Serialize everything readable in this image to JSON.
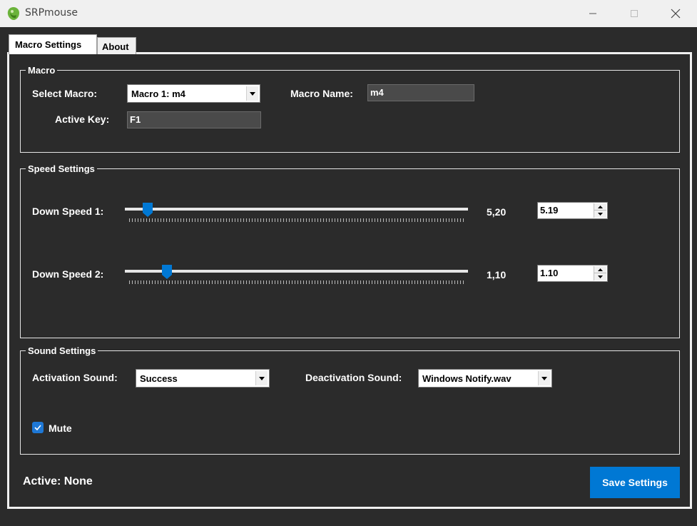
{
  "window": {
    "title": "SRPmouse"
  },
  "tabs": [
    {
      "label": "Macro Settings",
      "active": true
    },
    {
      "label": "About",
      "active": false
    }
  ],
  "macro_group": {
    "title": "Macro",
    "select_label": "Select Macro:",
    "select_value": "Macro 1: m4",
    "name_label": "Macro Name:",
    "name_value": "m4",
    "key_label": "Active Key:",
    "key_value": "F1"
  },
  "speed_group": {
    "title": "Speed Settings",
    "sliders": [
      {
        "label": "Down Speed 1:",
        "display": "5,20",
        "input": "5.19",
        "fraction": 0.065
      },
      {
        "label": "Down Speed 2:",
        "display": "1,10",
        "input": "1.10",
        "fraction": 0.12
      }
    ]
  },
  "sound_group": {
    "title": "Sound Settings",
    "activation_label": "Activation Sound:",
    "activation_value": "Success",
    "deactivation_label": "Deactivation Sound:",
    "deactivation_value": "Windows Notify.wav",
    "mute_label": "Mute",
    "mute_checked": true
  },
  "status": "Active: None",
  "save_label": "Save Settings",
  "colors": {
    "accent": "#0078d4",
    "background": "#2b2b2b",
    "titlebar": "#f0f0f0"
  },
  "icons": [
    "app-icon",
    "minimize-icon",
    "maximize-icon",
    "close-icon",
    "dropdown-arrow-icon",
    "checkmark-icon",
    "spin-up-icon",
    "spin-down-icon"
  ]
}
